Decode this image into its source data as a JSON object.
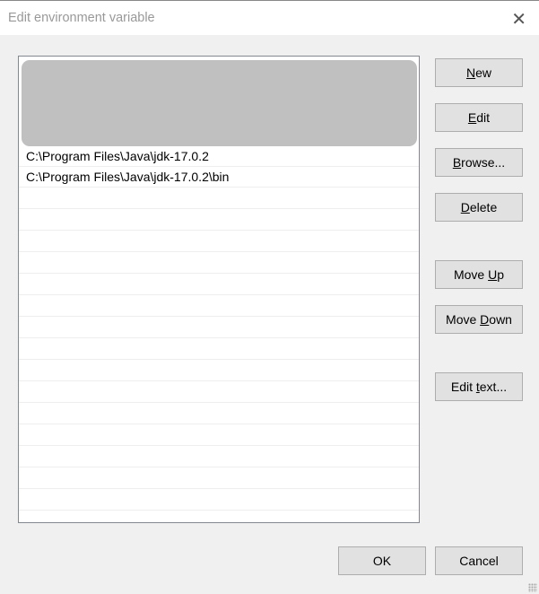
{
  "window": {
    "title": "Edit environment variable",
    "close_icon": "close-icon"
  },
  "list": {
    "items": [
      {
        "text": "C:\\Program Files\\Java\\jdk-17.0.2"
      },
      {
        "text": "C:\\Program Files\\Java\\jdk-17.0.2\\bin"
      }
    ]
  },
  "buttons": {
    "new": {
      "pre": "",
      "key": "N",
      "post": "ew"
    },
    "edit": {
      "pre": "",
      "key": "E",
      "post": "dit"
    },
    "browse": {
      "pre": "",
      "key": "B",
      "post": "rowse..."
    },
    "delete": {
      "pre": "",
      "key": "D",
      "post": "elete"
    },
    "move_up": {
      "pre": "Move ",
      "key": "U",
      "post": "p"
    },
    "move_down": {
      "pre": "Move ",
      "key": "D",
      "post": "own"
    },
    "edit_text": {
      "pre": "Edit ",
      "key": "t",
      "post": "ext..."
    },
    "ok": "OK",
    "cancel": "Cancel"
  }
}
